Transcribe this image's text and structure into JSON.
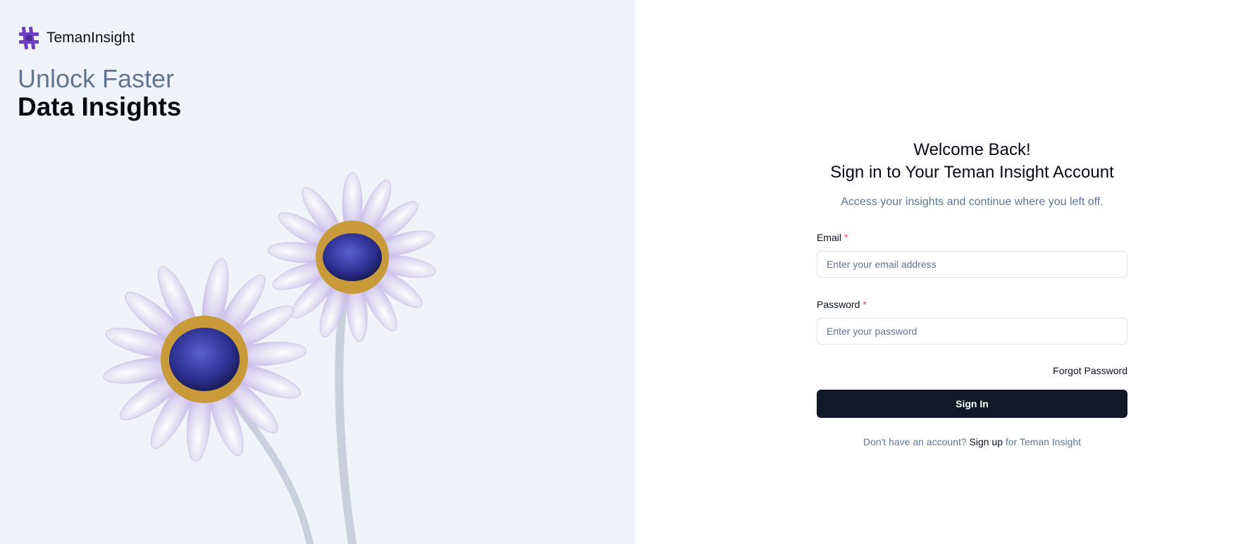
{
  "brand": {
    "name": "TemanInsight",
    "logo_icon": "teman-insight-logo-icon",
    "logo_color": "#6d3fc0"
  },
  "hero": {
    "line1": "Unlock Faster",
    "line2": "Data Insights",
    "image": "glass-flowers-illustration"
  },
  "form": {
    "title_line1": "Welcome Back!",
    "title_line2": "Sign in to Your Teman Insight Account",
    "subtitle": "Access your insights and continue where you left off.",
    "email": {
      "label": "Email",
      "required_mark": "*",
      "placeholder": "Enter your email address",
      "value": ""
    },
    "password": {
      "label": "Password",
      "required_mark": "*",
      "placeholder": "Enter your password",
      "value": ""
    },
    "forgot_password": "Forgot Password",
    "submit_label": "Sign In",
    "signup_prefix": "Don't have an account?",
    "signup_link": "Sign up",
    "signup_suffix": "for Teman Insight"
  },
  "colors": {
    "left_bg": "#f0f3f9",
    "button_bg": "#111827",
    "required": "#e5484d",
    "muted": "#5f7591"
  }
}
